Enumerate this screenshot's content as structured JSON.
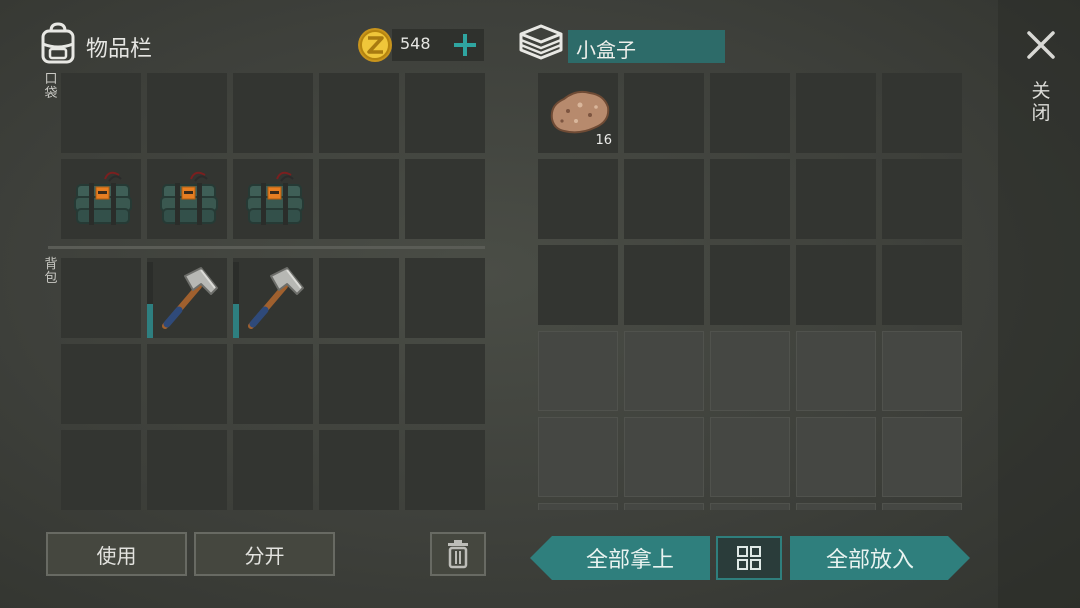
{
  "inventory": {
    "title": "物品栏",
    "money": "548",
    "pocket_label": "口袋",
    "backpack_label": "背包",
    "pocket_slots": [
      {
        "item": null
      },
      {
        "item": null
      },
      {
        "item": null
      },
      {
        "item": null
      },
      {
        "item": null
      },
      {
        "item": "c4-explosive"
      },
      {
        "item": "c4-explosive"
      },
      {
        "item": "c4-explosive"
      },
      {
        "item": null
      },
      {
        "item": null
      }
    ],
    "backpack_slots": [
      {
        "item": null
      },
      {
        "item": "pickaxe",
        "durability": 0.45
      },
      {
        "item": "pickaxe",
        "durability": 0.45
      },
      {
        "item": null
      },
      {
        "item": null
      },
      {
        "item": null
      },
      {
        "item": null
      },
      {
        "item": null
      },
      {
        "item": null
      },
      {
        "item": null
      },
      {
        "item": null
      },
      {
        "item": null
      },
      {
        "item": null
      },
      {
        "item": null
      },
      {
        "item": null
      }
    ]
  },
  "container": {
    "title": "小盒子",
    "slots_active": 15,
    "slots_total": 30,
    "items": [
      {
        "slot": 0,
        "item": "stone-ore",
        "qty": "16"
      }
    ]
  },
  "buttons": {
    "use": "使用",
    "split": "分开",
    "take_all": "全部拿上",
    "put_all": "全部放入",
    "close": "关闭"
  },
  "colors": {
    "accent_teal": "#2f7f7d",
    "coin_gold": "#e2b32a",
    "background": "#3e403b"
  },
  "icons": {
    "backpack": "backpack-icon",
    "coin": "coin-icon",
    "add": "plus-icon",
    "box": "box-icon",
    "close": "close-icon",
    "trash": "trash-icon",
    "sort": "grid-sort-icon"
  }
}
